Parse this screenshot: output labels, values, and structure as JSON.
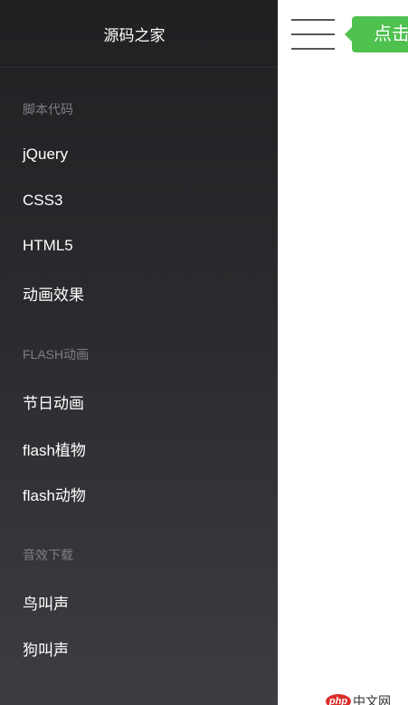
{
  "sidebar": {
    "brand": "源码之家",
    "sections": [
      {
        "title": "脚本代码",
        "items": [
          "jQuery",
          "CSS3",
          "HTML5",
          "动画效果"
        ]
      },
      {
        "title": "FLASH动画",
        "items": [
          "节日动画",
          "flash植物",
          "flash动物"
        ]
      },
      {
        "title": "音效下载",
        "items": [
          "鸟叫声",
          "狗叫声"
        ]
      }
    ]
  },
  "header": {
    "click_label": "点击"
  },
  "watermark": {
    "logo": "php",
    "text": "中文网"
  },
  "colors": {
    "sidebar_top": "#1f2022",
    "sidebar_bottom": "#3c3d41",
    "accent_green": "#4ec14e",
    "section_title": "#7d7e82",
    "logo_red": "#d9302c"
  }
}
